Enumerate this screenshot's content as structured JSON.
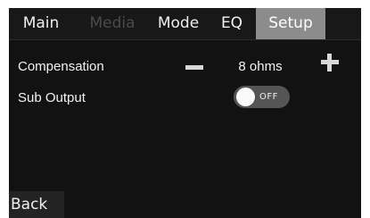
{
  "tabs": [
    {
      "label": "Main",
      "state": "normal"
    },
    {
      "label": "Media",
      "state": "disabled"
    },
    {
      "label": "Mode",
      "state": "normal"
    },
    {
      "label": "EQ",
      "state": "normal"
    },
    {
      "label": "Setup",
      "state": "active"
    }
  ],
  "settings": {
    "compensation": {
      "label": "Compensation",
      "value": "8 ohms",
      "decrease_icon": "minus-icon",
      "increase_icon": "plus-icon"
    },
    "sub_output": {
      "label": "Sub Output",
      "toggle_state": "OFF",
      "enabled": false
    }
  },
  "footer": {
    "back_label": "Back"
  },
  "colors": {
    "background": "#121212",
    "active_tab": "#8c8c8c",
    "disabled_text": "#4a4a4a",
    "toggle_track": "#555555"
  }
}
